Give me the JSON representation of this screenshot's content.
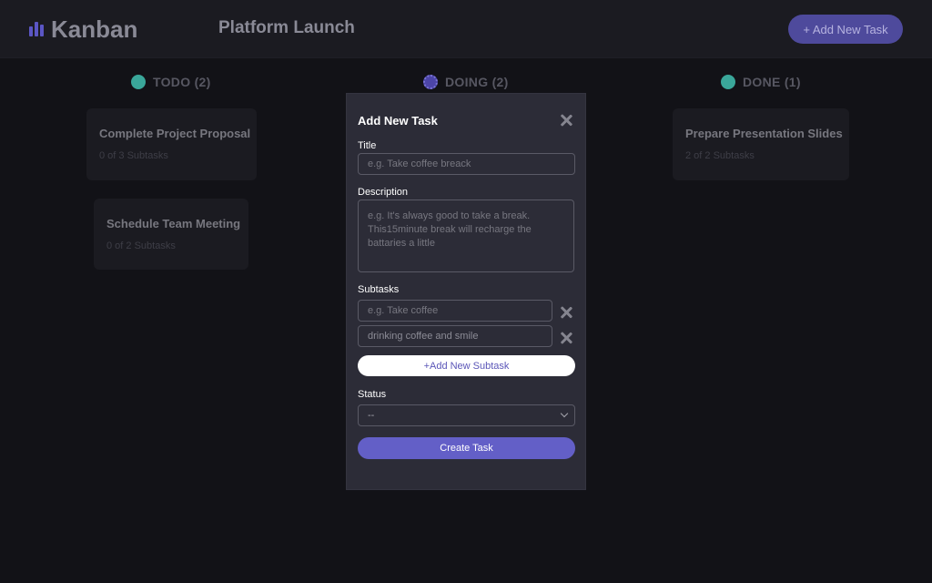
{
  "header": {
    "logo_text": "Kanban",
    "board_title": "Platform Launch",
    "add_task_label": "+ Add New Task"
  },
  "columns": [
    {
      "name": "TODO (2)",
      "dot_color": "#3aa79a",
      "cards": [
        {
          "title": "Complete Project Proposal",
          "subtasks": "0 of 3 Subtasks"
        },
        {
          "title": "Schedule Team Meeting",
          "subtasks": "0 of 2 Subtasks"
        }
      ]
    },
    {
      "name": "DOING (2)",
      "dot_color": "#4c45a8",
      "cards": []
    },
    {
      "name": "DONE (1)",
      "dot_color": "#3aa79a",
      "cards": [
        {
          "title": "Prepare Presentation Slides",
          "subtasks": "2 of 2 Subtasks"
        }
      ]
    }
  ],
  "modal": {
    "title": "Add New Task",
    "title_label": "Title",
    "title_placeholder": "e.g. Take coffee breack",
    "description_label": "Description",
    "description_placeholder": "e.g. It's always good to take a break. This15minute break will recharge the battaries a little",
    "subtasks_label": "Subtasks",
    "subtasks": [
      {
        "value": "",
        "placeholder": "e.g. Take coffee"
      },
      {
        "value": "drinking coffee and smile",
        "placeholder": ""
      }
    ],
    "add_subtask_label": "+Add New Subtask",
    "status_label": "Status",
    "status_value": "--",
    "create_label": "Create Task"
  },
  "colors": {
    "accent": "#635fc7",
    "background": "#121217",
    "modal_bg": "#2c2c37"
  }
}
